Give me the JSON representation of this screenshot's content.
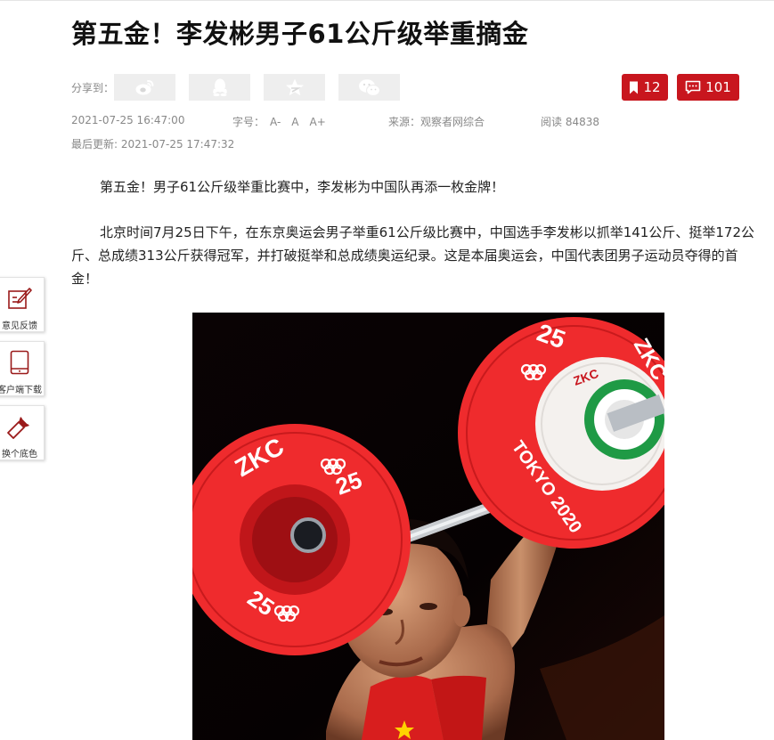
{
  "article": {
    "title": "第五金！李发彬男子61公斤级举重摘金",
    "paragraph1": "第五金！男子61公斤级举重比赛中，李发彬为中国队再添一枚金牌！",
    "paragraph2": "北京时间7月25日下午，在东京奥运会男子举重61公斤级比赛中，中国选手李发彬以抓举141公斤、挺举172公斤、总成绩313公斤获得冠军，并打破挺举和总成绩奥运纪录。这是本届奥运会，中国代表团男子运动员夺得的首金！"
  },
  "share": {
    "label": "分享到：",
    "icons": [
      "weibo-icon",
      "qq-icon",
      "qzone-star-icon",
      "wechat-icon"
    ]
  },
  "counters": {
    "bookmarks": "12",
    "comments": "101"
  },
  "meta": {
    "publish_time": "2021-07-25 16:47:00",
    "font_size_label": "字号：",
    "font_small": "A-",
    "font_normal": "A",
    "font_large": "A+",
    "source": "来源：观察者网综合",
    "reads": "阅读 84838",
    "updated": "最后更新: 2021-07-25 17:47:32"
  },
  "photo": {
    "plate_number": "25",
    "plate_brand": "ZKC",
    "plate_text": "TOKYO 2020"
  },
  "sidebar": {
    "feedback": "意见反馈",
    "download": "客户端下载",
    "background": "换个底色"
  },
  "colors": {
    "accent": "#c8161e",
    "muted": "#888888"
  }
}
